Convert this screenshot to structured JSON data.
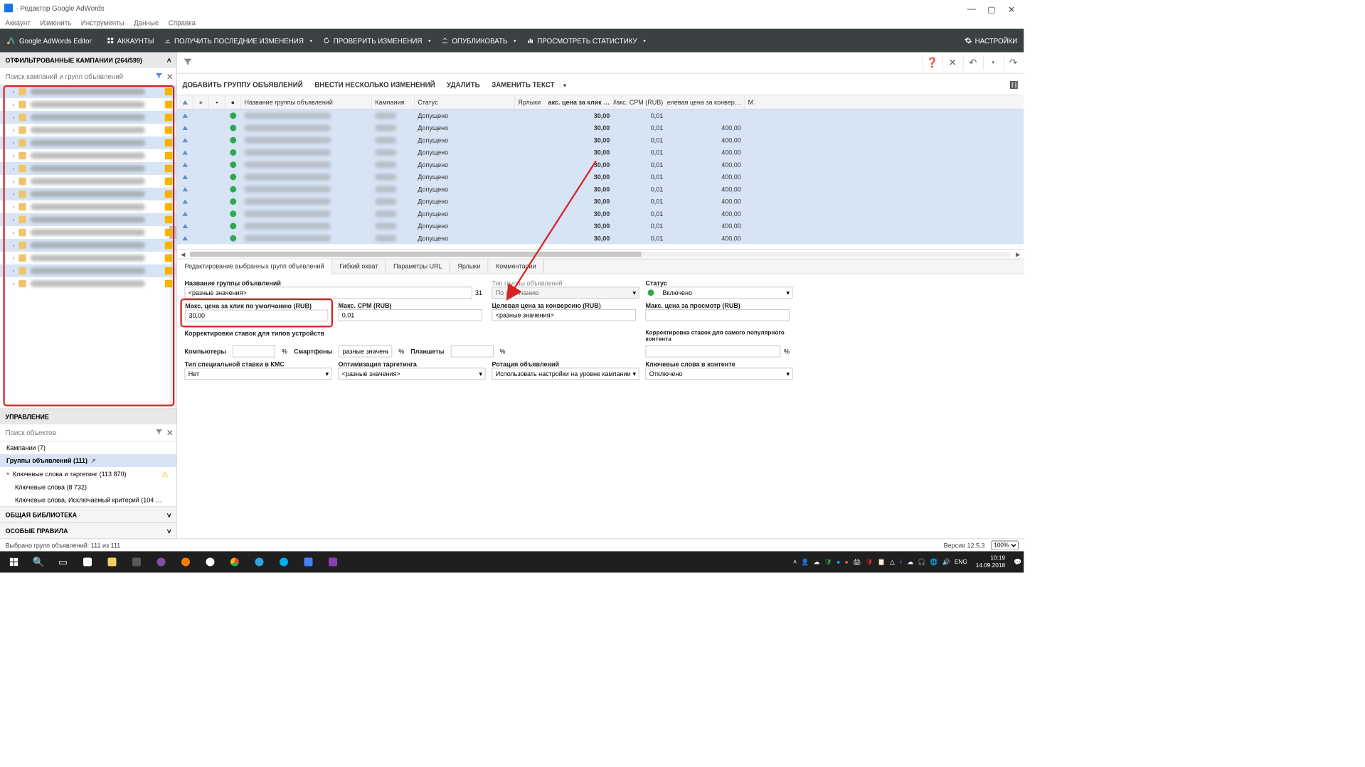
{
  "window": {
    "title": " · Редактор Google AdWords",
    "minimize": "—",
    "maximize": "▢",
    "close": "✕"
  },
  "menubar": {
    "account": "Аккаунт",
    "edit": "Изменить",
    "tools": "Инструменты",
    "data": "Данные",
    "help": "Справка"
  },
  "toolbar": {
    "brand": "Google AdWords Editor",
    "accounts": "АККАУНТЫ",
    "get_changes": "ПОЛУЧИТЬ ПОСЛЕДНИЕ ИЗМЕНЕНИЯ",
    "check_changes": "ПРОВЕРИТЬ ИЗМЕНЕНИЯ",
    "publish": "ОПУБЛИКОВАТЬ",
    "view_stats": "ПРОСМОТРЕТЬ СТАТИСТИКУ",
    "settings": "НАСТРОЙКИ"
  },
  "sidebar": {
    "filtered_header": "ОТФИЛЬТРОВАННЫЕ КАМПАНИИ (264/599)",
    "search_placeholder": "Поиск кампаний и групп объявлений",
    "management_header": "УПРАВЛЕНИЕ",
    "search_objects_placeholder": "Поиск объектов",
    "obj_campaigns": "Кампании (7)",
    "obj_adgroups": "Группы объявлений (111)",
    "obj_kw_targeting": "Ключевые слова и таргетинг (113 870)",
    "obj_keywords": "Ключевые слова (8 732)",
    "obj_neg_keywords": "Ключевые слова, Исключаемый критерий (104 …",
    "shared_library": "ОБЩАЯ БИБЛИОТЕКА",
    "special_rules": "ОСОБЫЕ ПРАВИЛА"
  },
  "actionbar": {
    "add_group": "ДОБАВИТЬ ГРУППУ ОБЪЯВЛЕНИЙ",
    "bulk_changes": "ВНЕСТИ НЕСКОЛЬКО ИЗМЕНЕНИЙ",
    "delete": "УДАЛИТЬ",
    "replace_text": "ЗАМЕНИТЬ ТЕКСТ"
  },
  "grid": {
    "headers": {
      "name": "Название группы объявлений",
      "campaign": "Кампания",
      "status": "Статус",
      "labels": "Ярлыки",
      "max_cpc": "Макс. цена за клик …",
      "max_cpm": "Макс. CPM (RUB)",
      "target_conv": "Целевая цена за конвер…",
      "last": "М"
    },
    "rows": [
      {
        "status": "Допущено",
        "cpc": "30,00",
        "cpm": "0,01",
        "conv": ""
      },
      {
        "status": "Допущено",
        "cpc": "30,00",
        "cpm": "0,01",
        "conv": "400,00"
      },
      {
        "status": "Допущено",
        "cpc": "30,00",
        "cpm": "0,01",
        "conv": "400,00"
      },
      {
        "status": "Допущено",
        "cpc": "30,00",
        "cpm": "0,01",
        "conv": "400,00"
      },
      {
        "status": "Допущено",
        "cpc": "30,00",
        "cpm": "0,01",
        "conv": "400,00"
      },
      {
        "status": "Допущено",
        "cpc": "30,00",
        "cpm": "0,01",
        "conv": "400,00"
      },
      {
        "status": "Допущено",
        "cpc": "30,00",
        "cpm": "0,01",
        "conv": "400,00"
      },
      {
        "status": "Допущено",
        "cpc": "30,00",
        "cpm": "0,01",
        "conv": "400,00"
      },
      {
        "status": "Допущено",
        "cpc": "30,00",
        "cpm": "0,01",
        "conv": "400,00"
      },
      {
        "status": "Допущено",
        "cpc": "30,00",
        "cpm": "0,01",
        "conv": "400,00"
      },
      {
        "status": "Допущено",
        "cpc": "30,00",
        "cpm": "0,01",
        "conv": "400,00"
      }
    ]
  },
  "tabs": {
    "edit": "Редактирование выбранных групп объявлений",
    "flex_reach": "Гибкий охват",
    "url_params": "Параметры URL",
    "labels": "Ярлыки",
    "comments": "Комментарии"
  },
  "editor": {
    "group_name_label": "Название группы объявлений",
    "group_name_value": "<разные значения>",
    "group_count": "31",
    "group_type_label": "Тип группы объявлений",
    "group_type_value": "По умолчанию",
    "status_label": "Статус",
    "status_value": "Включено",
    "max_cpc_label": "Макс. цена за клик по умолчанию (RUB)",
    "max_cpc_value": "30,00",
    "max_cpm_label": "Макс. CPM (RUB)",
    "max_cpm_value": "0,01",
    "target_conv_label": "Целевая цена за конверсию (RUB)",
    "target_conv_value": "<разные значения>",
    "max_view_label": "Макс. цена за просмотр (RUB)",
    "device_adj_label": "Корректировки ставок для типов устройств",
    "computers": "Компьютеры",
    "smartphones": "Смартфоны",
    "smartphones_value": "разные значения>",
    "tablets": "Планшеты",
    "percent": "%",
    "popular_content_label": "Корректировка ставок для самого популярного контента",
    "special_bid_label": "Тип специальной ставки в КМС",
    "special_bid_value": "Нет",
    "targeting_opt_label": "Оптимизация таргетинга",
    "targeting_opt_value": "<разные значения>",
    "ad_rotation_label": "Ротация объявлений",
    "ad_rotation_value": "Использовать настройки на уровне кампании",
    "kw_content_label": "Ключевые слова в контенте",
    "kw_content_value": "Отключено"
  },
  "statusbar": {
    "selected": "Выбрано групп объявлений: 111 из 111",
    "version": "Версия 12.5.3",
    "zoom": "100%"
  },
  "taskbar": {
    "lang": "ENG",
    "time": "10:19",
    "date": "14.09.2018"
  }
}
